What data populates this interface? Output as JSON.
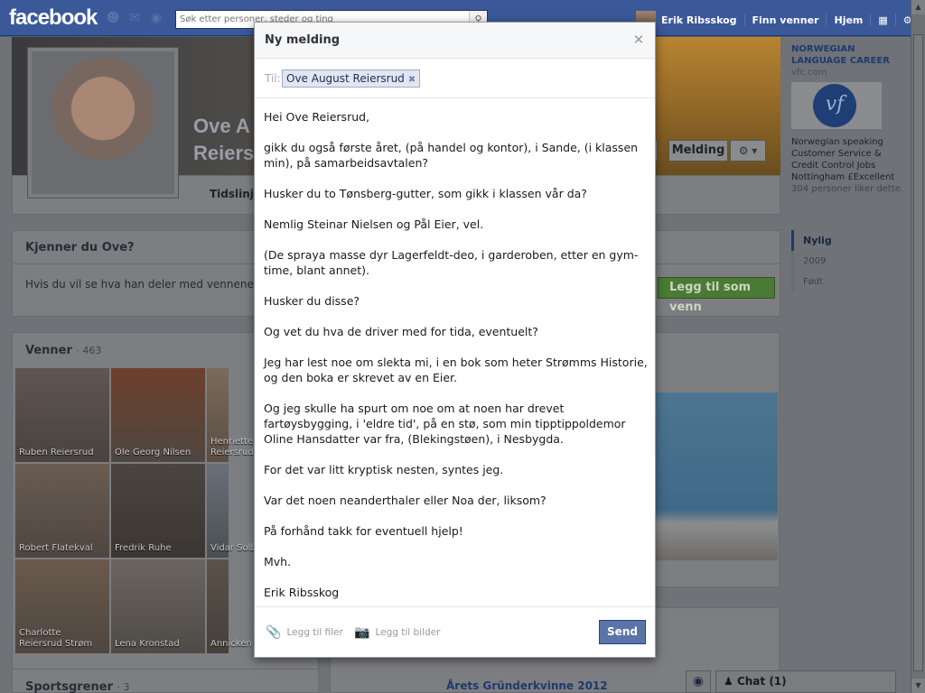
{
  "topbar": {
    "logo": "facebook",
    "search_placeholder": "Søk etter personer, steder og ting",
    "user_name": "Erik Ribsskog",
    "find_friends": "Finn venner",
    "home": "Hjem"
  },
  "profile": {
    "name_line1": "Ove A",
    "name_line2": "Reiers",
    "tab_timeline": "Tidslinje",
    "message_button": "Melding"
  },
  "know_panel": {
    "title": "Kjenner du Ove?",
    "text": "Hvis du vil se hva han deler med vennene sine",
    "add_friend": "Legg til som venn"
  },
  "friends": {
    "title": "Venner",
    "count": "· 463",
    "items": [
      {
        "name": "Ruben Reiersrud"
      },
      {
        "name": "Ole Georg Nilsen"
      },
      {
        "name": "Henriette Reiersrud"
      },
      {
        "name": "Robert Flatekval"
      },
      {
        "name": "Fredrik Ruhe"
      },
      {
        "name": "Vidar Solb"
      },
      {
        "name": "Charlotte Reiersrud Strøm"
      },
      {
        "name": "Lena Kronstad"
      },
      {
        "name": "Annicken"
      }
    ]
  },
  "sports": {
    "title": "Sportsgrener",
    "count": "· 3"
  },
  "article": {
    "title": "Årets Gründerkvinne 2012"
  },
  "ad": {
    "title": "NORWEGIAN LANGUAGE CAREER",
    "url": "vfc.com",
    "logo_text": "vf",
    "body": "Norwegian speaking Customer Service & Credit Control Jobs Nottingham £Excellent",
    "likes": "304 personer liker dette."
  },
  "timeline_nav": {
    "items": [
      "Nylig",
      "2009",
      "Født"
    ]
  },
  "chat": {
    "label": "Chat (1)"
  },
  "modal": {
    "title": "Ny melding",
    "to_label": "Til:",
    "recipient": "Ove August Reiersrud",
    "body": [
      "Hei Ove Reiersrud,",
      "gikk du også første året, (på handel og kontor), i Sande, (i klassen min), på samarbeidsavtalen?",
      "Husker du to Tønsberg-gutter, som gikk i klassen vår da?",
      "Nemlig Steinar Nielsen og Pål Eier, vel.",
      "(De spraya masse dyr Lagerfeldt-deo, i garderoben, etter en gym-time, blant annet).",
      "Husker du disse?",
      "Og vet du hva de driver med for tida, eventuelt?",
      "Jeg har lest noe om slekta mi, i en bok som heter Strømms Historie, og den boka er skrevet av en Eier.",
      "Og jeg skulle ha spurt om noe om at noen har drevet fartøysbygging, i 'eldre tid', på en stø, som min tipptippoldemor Oline Hansdatter var fra, (Blekingstøen), i Nesbygda.",
      "For det var litt kryptisk nesten, syntes jeg.",
      "Var det noen neanderthaler eller Noa der, liksom?",
      "På forhånd takk for eventuell hjelp!",
      "Mvh.",
      "Erik Ribsskog"
    ],
    "attach_files": "Legg til filer",
    "attach_photos": "Legg til bilder",
    "send": "Send"
  }
}
